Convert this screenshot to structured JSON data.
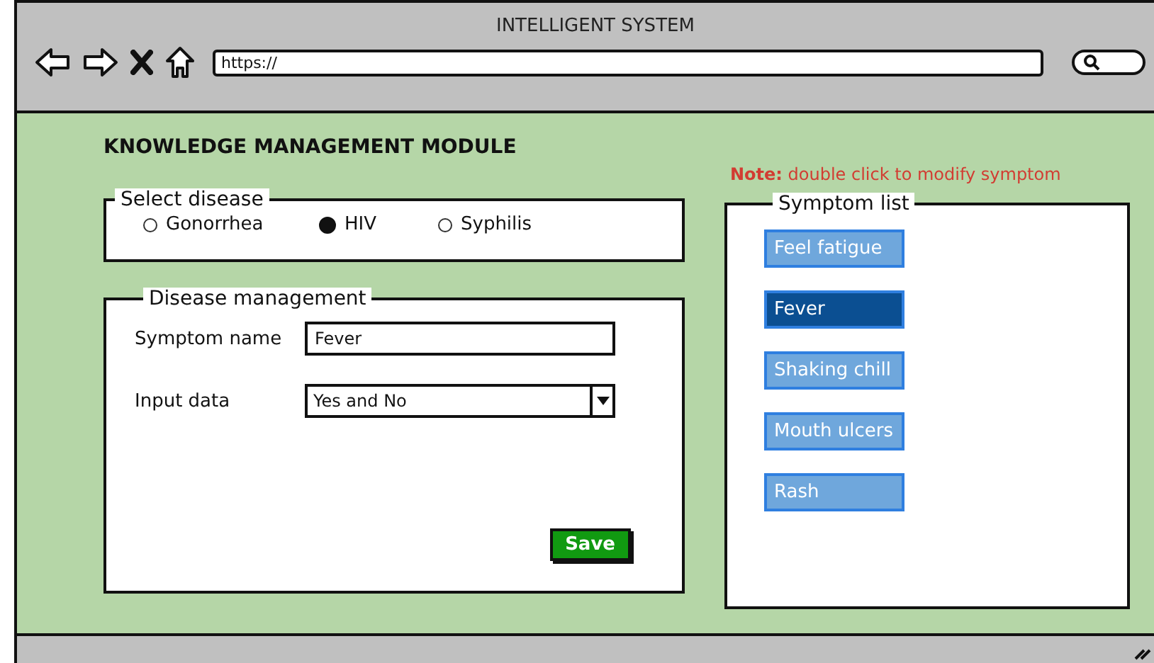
{
  "window": {
    "title": "INTELLIGENT SYSTEM"
  },
  "browser": {
    "address": "https://"
  },
  "page": {
    "heading": "KNOWLEDGE MANAGEMENT MODULE",
    "note": "**Note:**  double click to modify symptom"
  },
  "select_disease": {
    "title": "Select disease",
    "options": [
      {
        "label": "Gonorrhea",
        "selected": false
      },
      {
        "label": "HIV",
        "selected": true
      },
      {
        "label": "Syphilis",
        "selected": false
      }
    ]
  },
  "disease_management": {
    "title": "Disease management",
    "fields": [
      {
        "kind": "text",
        "label": "Symptom name",
        "value": "Fever"
      },
      {
        "kind": "dropdown",
        "label": "Input data",
        "value": "Yes and No"
      }
    ],
    "button": "Save"
  },
  "symptom_list": {
    "title": "Symptom list",
    "items": [
      {
        "label": "Feel fatigue",
        "selected": false
      },
      {
        "label": "Fever",
        "selected": true
      },
      {
        "label": "Shaking chill",
        "selected": false
      },
      {
        "label": "Mouth ulcers",
        "selected": false
      },
      {
        "label": "Rash",
        "selected": false
      }
    ]
  }
}
